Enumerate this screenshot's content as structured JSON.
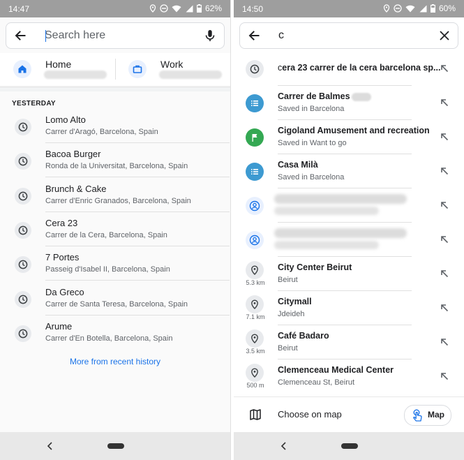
{
  "left": {
    "status": {
      "time": "14:47",
      "battery": "62%"
    },
    "search": {
      "placeholder": "Search here"
    },
    "shortcuts": [
      {
        "label": "Home",
        "icon": "home-icon"
      },
      {
        "label": "Work",
        "icon": "briefcase-icon"
      }
    ],
    "section_title": "YESTERDAY",
    "history": [
      {
        "name": "Lomo Alto",
        "address": "Carrer d'Aragó, Barcelona, Spain"
      },
      {
        "name": "Bacoa Burger",
        "address": "Ronda de la Universitat, Barcelona, Spain"
      },
      {
        "name": "Brunch & Cake",
        "address": "Carrer d'Enric Granados, Barcelona, Spain"
      },
      {
        "name": "Cera 23",
        "address": "Carrer de la Cera, Barcelona, Spain"
      },
      {
        "name": "7 Portes",
        "address": "Passeig d'Isabel II, Barcelona, Spain"
      },
      {
        "name": "Da Greco",
        "address": "Carrer de Santa Teresa, Barcelona, Spain"
      },
      {
        "name": "Arume",
        "address": "Carrer d'En Botella, Barcelona, Spain"
      }
    ],
    "more_label": "More from recent history"
  },
  "right": {
    "status": {
      "time": "14:50",
      "battery": "60%"
    },
    "search": {
      "value": "c"
    },
    "suggestions": [
      {
        "kind": "history",
        "icon": "clock-icon",
        "typed": "c",
        "rest": "era 23 carrer de la cera barcelona sp..."
      },
      {
        "kind": "saved",
        "icon": "list-icon",
        "title": "Carrer de Balmes",
        "subtitle": "Saved in Barcelona"
      },
      {
        "kind": "want",
        "icon": "flag-icon",
        "title": "Cigoland Amusement and recreation",
        "subtitle": "Saved in Want to go"
      },
      {
        "kind": "saved",
        "icon": "list-icon",
        "title": "Casa Milà",
        "subtitle": "Saved in Barcelona"
      },
      {
        "kind": "contact",
        "icon": "person-icon"
      },
      {
        "kind": "contact",
        "icon": "person-icon"
      },
      {
        "kind": "place",
        "icon": "pin-icon",
        "distance": "5.3 km",
        "title": "City Center Beirut",
        "subtitle": "Beirut"
      },
      {
        "kind": "place",
        "icon": "pin-icon",
        "distance": "7.1 km",
        "title": "Citymall",
        "subtitle": "Jdeideh"
      },
      {
        "kind": "place",
        "icon": "pin-icon",
        "distance": "3.5 km",
        "title": "Café Badaro",
        "subtitle": "Beirut"
      },
      {
        "kind": "place",
        "icon": "pin-icon",
        "distance": "500 m",
        "title": "Clemenceau Medical Center",
        "subtitle": "Clemenceau St, Beirut"
      }
    ],
    "choose_label": "Choose on map",
    "map_button_label": "Map"
  },
  "colors": {
    "accent": "#1a73e8",
    "teal": "#3d9ad1",
    "green": "#34a853",
    "statusbar": "#9e9e9e"
  }
}
